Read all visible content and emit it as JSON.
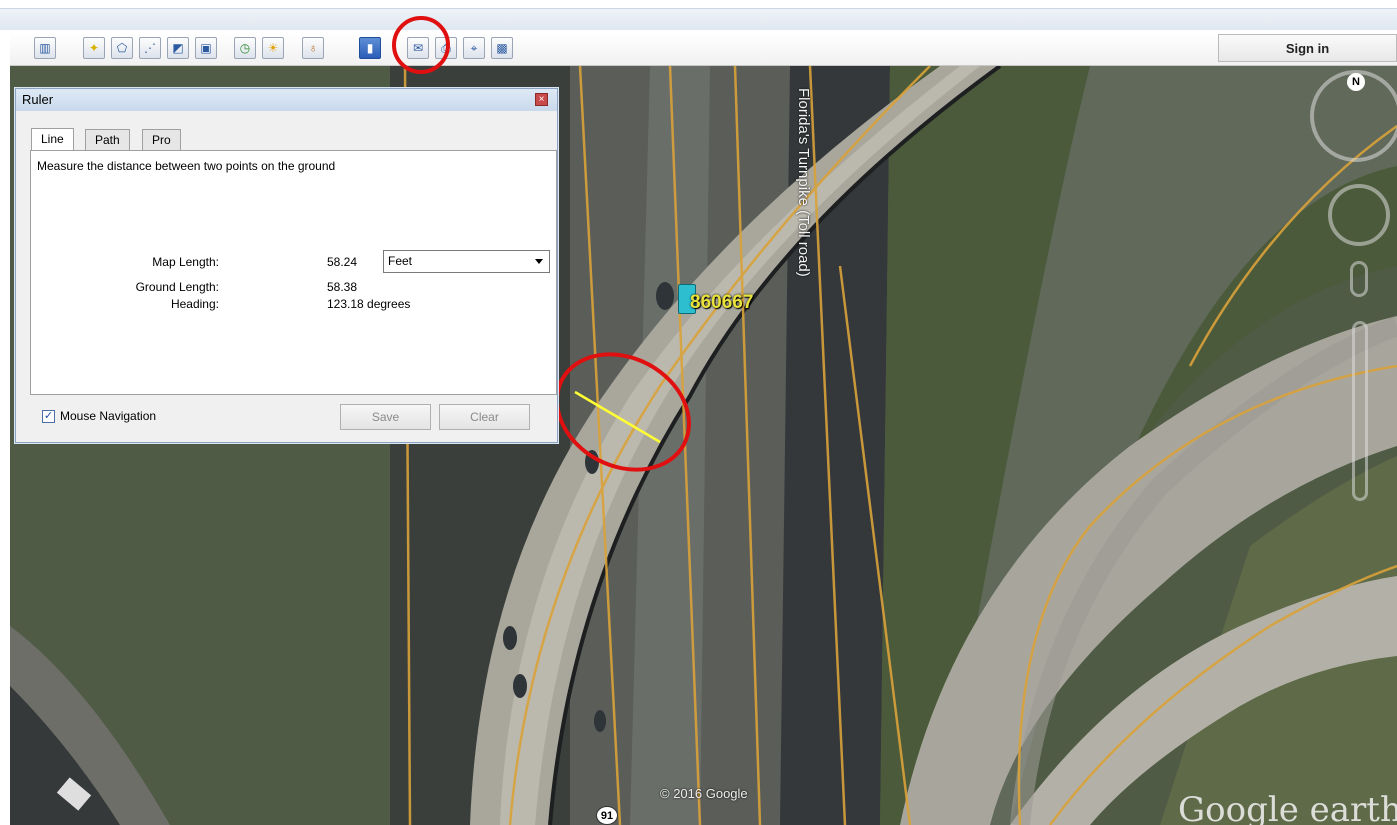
{
  "header": {
    "sign_in_label": "Sign in"
  },
  "toolbar": {
    "buttons": [
      {
        "name": "sidebar-toggle-button",
        "icon": "sidebar-icon"
      },
      {
        "name": "add-placemark-button",
        "icon": "pushpin-icon"
      },
      {
        "name": "add-polygon-button",
        "icon": "polygon-icon"
      },
      {
        "name": "add-path-button",
        "icon": "path-icon"
      },
      {
        "name": "add-image-overlay-button",
        "icon": "overlay-icon"
      },
      {
        "name": "record-tour-button",
        "icon": "camera-icon"
      },
      {
        "name": "historical-imagery-button",
        "icon": "clock-icon"
      },
      {
        "name": "sunlight-button",
        "icon": "sun-icon"
      },
      {
        "name": "planets-button",
        "icon": "planet-icon"
      },
      {
        "name": "ruler-button",
        "icon": "ruler-icon"
      },
      {
        "name": "email-button",
        "icon": "envelope-icon"
      },
      {
        "name": "print-button",
        "icon": "printer-icon"
      },
      {
        "name": "view-in-maps-button",
        "icon": "maps-icon"
      },
      {
        "name": "save-image-button",
        "icon": "image-icon"
      }
    ]
  },
  "ruler": {
    "title": "Ruler",
    "tabs": [
      "Line",
      "Path",
      "Pro"
    ],
    "selected_tab": "Line",
    "description": "Measure the distance between two points on the ground",
    "map_length_label": "Map Length:",
    "map_length_value": "58.24",
    "unit": "Feet",
    "ground_length_label": "Ground Length:",
    "ground_length_value": "58.38",
    "heading_label": "Heading:",
    "heading_value": "123.18 degrees",
    "mouse_navigation_label": "Mouse Navigation",
    "mouse_navigation_checked": true,
    "save_label": "Save",
    "clear_label": "Clear"
  },
  "map": {
    "placemark_label": "860667",
    "road_label": "Florida's Turnpike (Toll road)",
    "route_shield": "91",
    "copyright": "© 2016 Google",
    "brand": "Google earth",
    "north_label": "N"
  },
  "colors": {
    "highlight_red": "#e01010",
    "measure_line": "#ffff33",
    "road_lines": "#d9a23a",
    "placemark_label": "#e8e23a"
  }
}
